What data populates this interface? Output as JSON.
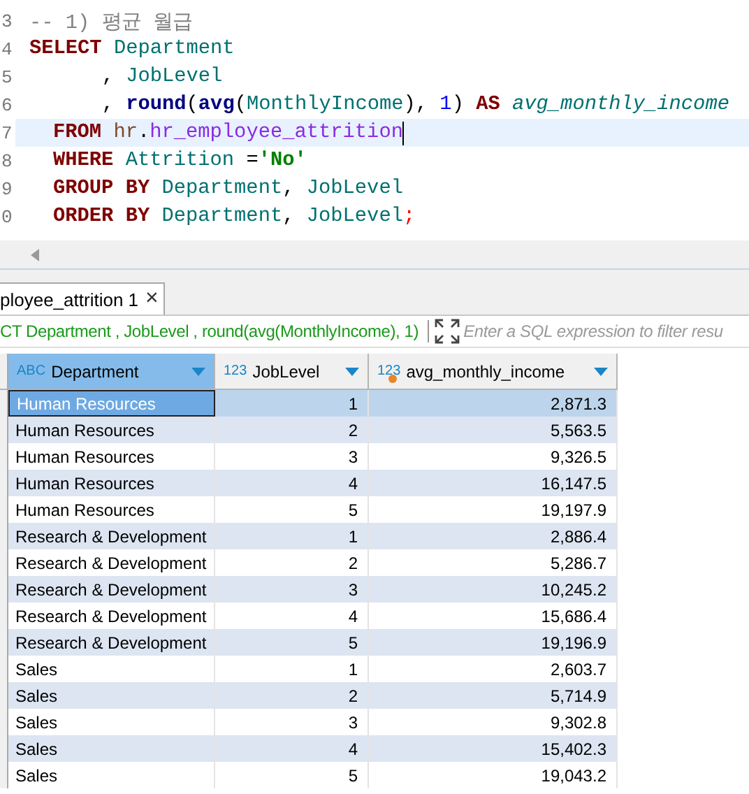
{
  "editor": {
    "lines": [
      {
        "number": "3",
        "current": false,
        "indented": false,
        "tokens": [
          {
            "kind": "comment",
            "text": "-- 1) 평균 월급"
          }
        ]
      },
      {
        "number": "4",
        "current": false,
        "indented": false,
        "tokens": [
          {
            "kind": "keyword",
            "text": "SELECT "
          },
          {
            "kind": "column",
            "text": "Department"
          }
        ]
      },
      {
        "number": "5",
        "current": false,
        "indented": false,
        "tokens": [
          {
            "kind": "plain",
            "text": "      , "
          },
          {
            "kind": "column",
            "text": "JobLevel"
          }
        ]
      },
      {
        "number": "6",
        "current": false,
        "indented": false,
        "tokens": [
          {
            "kind": "plain",
            "text": "      , "
          },
          {
            "kind": "function",
            "text": "round"
          },
          {
            "kind": "plain",
            "text": "("
          },
          {
            "kind": "function",
            "text": "avg"
          },
          {
            "kind": "plain",
            "text": "("
          },
          {
            "kind": "column",
            "text": "MonthlyIncome"
          },
          {
            "kind": "plain",
            "text": "), "
          },
          {
            "kind": "number",
            "text": "1"
          },
          {
            "kind": "plain",
            "text": ") "
          },
          {
            "kind": "keyword",
            "text": "AS "
          },
          {
            "kind": "alias",
            "text": "avg_monthly_income"
          }
        ]
      },
      {
        "number": "7",
        "current": true,
        "indented": true,
        "tokens": [
          {
            "kind": "keyword",
            "text": "FROM "
          },
          {
            "kind": "schema",
            "text": "hr"
          },
          {
            "kind": "plain",
            "text": "."
          },
          {
            "kind": "table",
            "text": "hr_employee_attrition"
          }
        ]
      },
      {
        "number": "8",
        "current": false,
        "indented": true,
        "tokens": [
          {
            "kind": "keyword",
            "text": "WHERE "
          },
          {
            "kind": "column",
            "text": "Attrition"
          },
          {
            "kind": "plain",
            "text": " ="
          },
          {
            "kind": "string",
            "text": "'No'"
          }
        ]
      },
      {
        "number": "9",
        "current": false,
        "indented": true,
        "tokens": [
          {
            "kind": "keyword",
            "text": "GROUP BY "
          },
          {
            "kind": "column",
            "text": "Department"
          },
          {
            "kind": "plain",
            "text": ", "
          },
          {
            "kind": "column",
            "text": "JobLevel"
          }
        ]
      },
      {
        "number": "0",
        "current": false,
        "indented": true,
        "tokens": [
          {
            "kind": "keyword",
            "text": "ORDER BY "
          },
          {
            "kind": "column",
            "text": "Department"
          },
          {
            "kind": "plain",
            "text": ", "
          },
          {
            "kind": "column",
            "text": "JobLevel"
          },
          {
            "kind": "semicolon",
            "text": ";"
          }
        ]
      }
    ]
  },
  "result_tab": {
    "label": "ployee_attrition 1",
    "close": "×"
  },
  "filter_bar": {
    "query": "CT Department , JobLevel , round(avg(MonthlyIncome), 1)",
    "placeholder": "Enter a SQL expression to filter resu"
  },
  "table": {
    "columns": [
      {
        "type_badge": "ABC",
        "kind": "text",
        "name": "Department",
        "selected": true
      },
      {
        "type_badge": "123",
        "kind": "number",
        "name": "JobLevel",
        "selected": false
      },
      {
        "type_badge": "123",
        "kind": "number",
        "name": "avg_monthly_income",
        "selected": false
      }
    ],
    "rows": [
      {
        "selected": true,
        "cells": [
          "Human Resources",
          "1",
          "2,871.3"
        ]
      },
      {
        "selected": false,
        "cells": [
          "Human Resources",
          "2",
          "5,563.5"
        ]
      },
      {
        "selected": false,
        "cells": [
          "Human Resources",
          "3",
          "9,326.5"
        ]
      },
      {
        "selected": false,
        "cells": [
          "Human Resources",
          "4",
          "16,147.5"
        ]
      },
      {
        "selected": false,
        "cells": [
          "Human Resources",
          "5",
          "19,197.9"
        ]
      },
      {
        "selected": false,
        "cells": [
          "Research & Development",
          "1",
          "2,886.4"
        ]
      },
      {
        "selected": false,
        "cells": [
          "Research & Development",
          "2",
          "5,286.7"
        ]
      },
      {
        "selected": false,
        "cells": [
          "Research & Development",
          "3",
          "10,245.2"
        ]
      },
      {
        "selected": false,
        "cells": [
          "Research & Development",
          "4",
          "15,686.4"
        ]
      },
      {
        "selected": false,
        "cells": [
          "Research & Development",
          "5",
          "19,196.9"
        ]
      },
      {
        "selected": false,
        "cells": [
          "Sales",
          "1",
          "2,603.7"
        ]
      },
      {
        "selected": false,
        "cells": [
          "Sales",
          "2",
          "5,714.9"
        ]
      },
      {
        "selected": false,
        "cells": [
          "Sales",
          "3",
          "9,302.8"
        ]
      },
      {
        "selected": false,
        "cells": [
          "Sales",
          "4",
          "15,402.3"
        ]
      },
      {
        "selected": false,
        "cells": [
          "Sales",
          "5",
          "19,043.2"
        ]
      }
    ]
  }
}
